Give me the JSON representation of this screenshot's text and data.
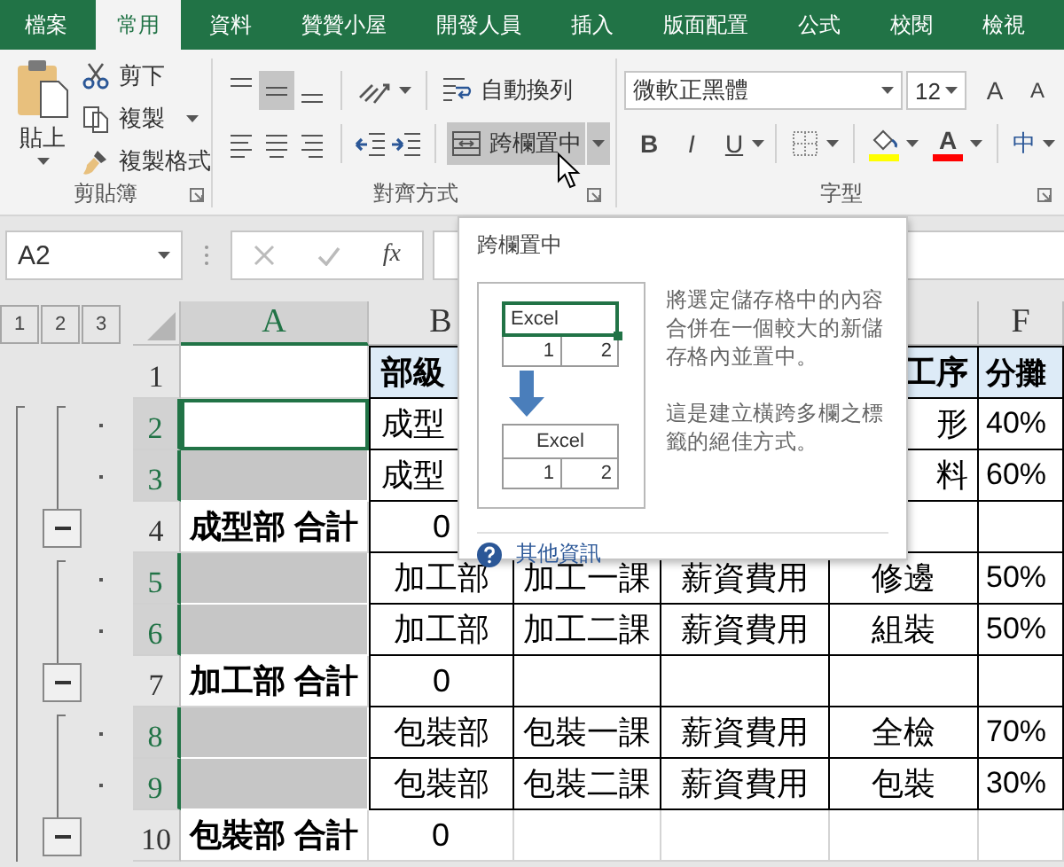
{
  "tabs": [
    {
      "label": "檔案",
      "selected": false
    },
    {
      "label": "常用",
      "selected": true
    },
    {
      "label": "資料",
      "selected": false
    },
    {
      "label": "贊贊小屋",
      "selected": false
    },
    {
      "label": "開發人員",
      "selected": false
    },
    {
      "label": "插入",
      "selected": false
    },
    {
      "label": "版面配置",
      "selected": false
    },
    {
      "label": "公式",
      "selected": false
    },
    {
      "label": "校閱",
      "selected": false
    },
    {
      "label": "檢視",
      "selected": false
    }
  ],
  "ribbon": {
    "clipboard": {
      "paste": "貼上",
      "cut": "剪下",
      "copy": "複製",
      "format_painter": "複製格式",
      "label": "剪貼簿"
    },
    "alignment": {
      "vertical": [
        {
          "kind": "top",
          "selected": false
        },
        {
          "kind": "middle",
          "selected": true
        },
        {
          "kind": "bottom",
          "selected": false
        }
      ],
      "horizontal": [
        {
          "kind": "left",
          "selected": false
        },
        {
          "kind": "center",
          "selected": false
        },
        {
          "kind": "right",
          "selected": false
        }
      ],
      "wrap_text": "自動換列",
      "merge_center": {
        "label": "跨欄置中",
        "hovered": true
      },
      "label": "對齊方式"
    },
    "font": {
      "name": "微軟正黑體",
      "size": "12",
      "grow": "A",
      "shrink": "A",
      "bold": "B",
      "italic": "I",
      "underline": "U",
      "fill_color": {
        "color": "#ffff00"
      },
      "font_color_letter": "A",
      "font_color": {
        "color": "#ff0000"
      },
      "phonetic": "中",
      "label": "字型"
    }
  },
  "formula_bar": {
    "name_box": "A2",
    "function": "fx"
  },
  "sheet": {
    "outline_levels": [
      "1",
      "2",
      "3"
    ],
    "columns": [
      {
        "label": "A",
        "selected": true
      },
      {
        "label": "B",
        "selected": false
      },
      {},
      {},
      {
        "selected": false
      },
      {
        "label": "F",
        "selected": false
      }
    ],
    "rows": [
      {
        "number": "1",
        "kind": "header",
        "selected": false,
        "active": false,
        "bordered": true,
        "cells": [
          {},
          {
            "text": "部級",
            "clipped": true
          },
          {},
          {},
          {
            "text": "工序",
            "clipped": true
          },
          {
            "text": "分攤"
          }
        ]
      },
      {
        "number": "2",
        "kind": "data",
        "selected": true,
        "active": true,
        "bordered": true,
        "cells": [
          {},
          {
            "text": "成型",
            "clipped": true
          },
          {},
          {},
          {
            "text": "形",
            "clipped": true
          },
          {
            "text": "40%"
          }
        ]
      },
      {
        "number": "3",
        "kind": "data",
        "selected": true,
        "active": false,
        "bordered": true,
        "cells": [
          {},
          {
            "text": "成型",
            "clipped": true
          },
          {},
          {},
          {
            "text": "料",
            "clipped": true
          },
          {
            "text": "60%"
          }
        ]
      },
      {
        "number": "4",
        "kind": "total",
        "selected": false,
        "active": false,
        "bordered": true,
        "cells": [
          {
            "text": "成型部 合計"
          },
          {
            "text": "0"
          },
          {},
          {},
          {},
          {}
        ]
      },
      {
        "number": "5",
        "kind": "data",
        "selected": true,
        "active": false,
        "bordered": true,
        "cells": [
          {},
          {
            "text": "加工部"
          },
          {
            "text": "加工一課"
          },
          {
            "text": "薪資費用"
          },
          {
            "text": "修邊"
          },
          {
            "text": "50%"
          }
        ]
      },
      {
        "number": "6",
        "kind": "data",
        "selected": true,
        "active": false,
        "bordered": true,
        "cells": [
          {},
          {
            "text": "加工部"
          },
          {
            "text": "加工二課"
          },
          {
            "text": "薪資費用"
          },
          {
            "text": "組裝"
          },
          {
            "text": "50%"
          }
        ]
      },
      {
        "number": "7",
        "kind": "total",
        "selected": false,
        "active": false,
        "bordered": true,
        "cells": [
          {
            "text": "加工部 合計"
          },
          {
            "text": "0"
          },
          {},
          {},
          {},
          {}
        ]
      },
      {
        "number": "8",
        "kind": "data",
        "selected": true,
        "active": false,
        "bordered": true,
        "cells": [
          {},
          {
            "text": "包裝部"
          },
          {
            "text": "包裝一課"
          },
          {
            "text": "薪資費用"
          },
          {
            "text": "全檢"
          },
          {
            "text": "70%"
          }
        ]
      },
      {
        "number": "9",
        "kind": "data",
        "selected": true,
        "active": false,
        "bordered": true,
        "cells": [
          {},
          {
            "text": "包裝部"
          },
          {
            "text": "包裝二課"
          },
          {
            "text": "薪資費用"
          },
          {
            "text": "包裝"
          },
          {
            "text": "30%"
          }
        ]
      },
      {
        "number": "10",
        "kind": "total",
        "selected": false,
        "active": false,
        "bordered": false,
        "cells": [
          {
            "text": "包裝部 合計"
          },
          {
            "text": "0"
          },
          {},
          {},
          {},
          {}
        ]
      }
    ]
  },
  "tooltip": {
    "title": "跨欄置中",
    "before": {
      "merged": "Excel",
      "cells": [
        "1",
        "2"
      ]
    },
    "after": {
      "merged": "Excel",
      "cells": [
        "1",
        "2"
      ]
    },
    "description": [
      "將選定儲存格中的內容合併在一個較大的新儲存格內並置中。",
      "這是建立橫跨多欄之標籤的絕佳方式。"
    ],
    "link": "其他資訊"
  }
}
